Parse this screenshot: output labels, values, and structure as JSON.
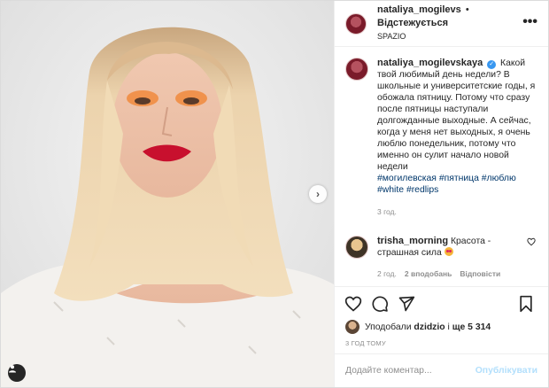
{
  "header": {
    "username": "nataliya_mogilevs",
    "separator": "•",
    "follow_state": "Відстежується",
    "location": "SPAZIO",
    "more_icon": "more-options-icon"
  },
  "caption": {
    "username": "nataliya_mogilevskaya",
    "verified": "✓",
    "text": "Какой твой любимый день недели? В школьные и университетские годы, я обожала пятницу. Потому что сразу после пятницы наступали долгожданные выходные. А сейчас, когда у меня нет выходных, я очень люблю понедельник, потому что именно он сулит начало новой недели",
    "hashtags": [
      "#могилевская",
      "#пятница",
      "#люблю",
      "#white",
      "#redlips"
    ],
    "time": "3 год."
  },
  "comment": {
    "username": "trisha_morning",
    "text": "Красота - страшная сила",
    "emoji": "heart-eyes-emoji",
    "time": "2 год.",
    "likes": "2 вподобань",
    "reply": "Відповісти"
  },
  "actions": {
    "like_icon": "heart-icon",
    "comment_icon": "comment-icon",
    "share_icon": "share-icon",
    "save_icon": "bookmark-icon"
  },
  "likes": {
    "prefix": "Уподобали",
    "user": "dzidzio",
    "conjunction": "і",
    "more": "ще 5 314"
  },
  "posted": "3 ГОД ТОМУ",
  "comment_box": {
    "placeholder": "Додайте коментар...",
    "publish": "Опублікувати"
  },
  "colors": {
    "link": "#00376b",
    "verified": "#3897f0",
    "publish_disabled": "#b2dffc",
    "muted": "#8e8e8e"
  }
}
